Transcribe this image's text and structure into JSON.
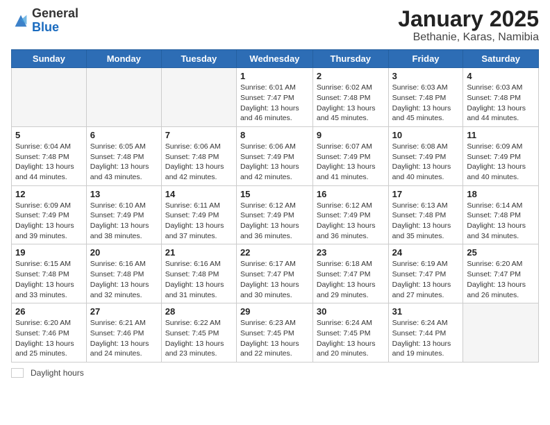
{
  "header": {
    "logo_general": "General",
    "logo_blue": "Blue",
    "title": "January 2025",
    "location": "Bethanie, Karas, Namibia"
  },
  "weekdays": [
    "Sunday",
    "Monday",
    "Tuesday",
    "Wednesday",
    "Thursday",
    "Friday",
    "Saturday"
  ],
  "weeks": [
    [
      {
        "day": "",
        "info": ""
      },
      {
        "day": "",
        "info": ""
      },
      {
        "day": "",
        "info": ""
      },
      {
        "day": "1",
        "info": "Sunrise: 6:01 AM\nSunset: 7:47 PM\nDaylight: 13 hours\nand 46 minutes."
      },
      {
        "day": "2",
        "info": "Sunrise: 6:02 AM\nSunset: 7:48 PM\nDaylight: 13 hours\nand 45 minutes."
      },
      {
        "day": "3",
        "info": "Sunrise: 6:03 AM\nSunset: 7:48 PM\nDaylight: 13 hours\nand 45 minutes."
      },
      {
        "day": "4",
        "info": "Sunrise: 6:03 AM\nSunset: 7:48 PM\nDaylight: 13 hours\nand 44 minutes."
      }
    ],
    [
      {
        "day": "5",
        "info": "Sunrise: 6:04 AM\nSunset: 7:48 PM\nDaylight: 13 hours\nand 44 minutes."
      },
      {
        "day": "6",
        "info": "Sunrise: 6:05 AM\nSunset: 7:48 PM\nDaylight: 13 hours\nand 43 minutes."
      },
      {
        "day": "7",
        "info": "Sunrise: 6:06 AM\nSunset: 7:48 PM\nDaylight: 13 hours\nand 42 minutes."
      },
      {
        "day": "8",
        "info": "Sunrise: 6:06 AM\nSunset: 7:49 PM\nDaylight: 13 hours\nand 42 minutes."
      },
      {
        "day": "9",
        "info": "Sunrise: 6:07 AM\nSunset: 7:49 PM\nDaylight: 13 hours\nand 41 minutes."
      },
      {
        "day": "10",
        "info": "Sunrise: 6:08 AM\nSunset: 7:49 PM\nDaylight: 13 hours\nand 40 minutes."
      },
      {
        "day": "11",
        "info": "Sunrise: 6:09 AM\nSunset: 7:49 PM\nDaylight: 13 hours\nand 40 minutes."
      }
    ],
    [
      {
        "day": "12",
        "info": "Sunrise: 6:09 AM\nSunset: 7:49 PM\nDaylight: 13 hours\nand 39 minutes."
      },
      {
        "day": "13",
        "info": "Sunrise: 6:10 AM\nSunset: 7:49 PM\nDaylight: 13 hours\nand 38 minutes."
      },
      {
        "day": "14",
        "info": "Sunrise: 6:11 AM\nSunset: 7:49 PM\nDaylight: 13 hours\nand 37 minutes."
      },
      {
        "day": "15",
        "info": "Sunrise: 6:12 AM\nSunset: 7:49 PM\nDaylight: 13 hours\nand 36 minutes."
      },
      {
        "day": "16",
        "info": "Sunrise: 6:12 AM\nSunset: 7:49 PM\nDaylight: 13 hours\nand 36 minutes."
      },
      {
        "day": "17",
        "info": "Sunrise: 6:13 AM\nSunset: 7:48 PM\nDaylight: 13 hours\nand 35 minutes."
      },
      {
        "day": "18",
        "info": "Sunrise: 6:14 AM\nSunset: 7:48 PM\nDaylight: 13 hours\nand 34 minutes."
      }
    ],
    [
      {
        "day": "19",
        "info": "Sunrise: 6:15 AM\nSunset: 7:48 PM\nDaylight: 13 hours\nand 33 minutes."
      },
      {
        "day": "20",
        "info": "Sunrise: 6:16 AM\nSunset: 7:48 PM\nDaylight: 13 hours\nand 32 minutes."
      },
      {
        "day": "21",
        "info": "Sunrise: 6:16 AM\nSunset: 7:48 PM\nDaylight: 13 hours\nand 31 minutes."
      },
      {
        "day": "22",
        "info": "Sunrise: 6:17 AM\nSunset: 7:47 PM\nDaylight: 13 hours\nand 30 minutes."
      },
      {
        "day": "23",
        "info": "Sunrise: 6:18 AM\nSunset: 7:47 PM\nDaylight: 13 hours\nand 29 minutes."
      },
      {
        "day": "24",
        "info": "Sunrise: 6:19 AM\nSunset: 7:47 PM\nDaylight: 13 hours\nand 27 minutes."
      },
      {
        "day": "25",
        "info": "Sunrise: 6:20 AM\nSunset: 7:47 PM\nDaylight: 13 hours\nand 26 minutes."
      }
    ],
    [
      {
        "day": "26",
        "info": "Sunrise: 6:20 AM\nSunset: 7:46 PM\nDaylight: 13 hours\nand 25 minutes."
      },
      {
        "day": "27",
        "info": "Sunrise: 6:21 AM\nSunset: 7:46 PM\nDaylight: 13 hours\nand 24 minutes."
      },
      {
        "day": "28",
        "info": "Sunrise: 6:22 AM\nSunset: 7:45 PM\nDaylight: 13 hours\nand 23 minutes."
      },
      {
        "day": "29",
        "info": "Sunrise: 6:23 AM\nSunset: 7:45 PM\nDaylight: 13 hours\nand 22 minutes."
      },
      {
        "day": "30",
        "info": "Sunrise: 6:24 AM\nSunset: 7:45 PM\nDaylight: 13 hours\nand 20 minutes."
      },
      {
        "day": "31",
        "info": "Sunrise: 6:24 AM\nSunset: 7:44 PM\nDaylight: 13 hours\nand 19 minutes."
      },
      {
        "day": "",
        "info": ""
      }
    ]
  ],
  "footer": {
    "legend_label": "Daylight hours"
  }
}
